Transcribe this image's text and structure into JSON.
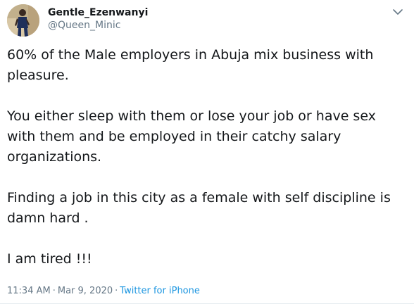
{
  "user": {
    "display_name": "Gentle_Ezenwanyi",
    "handle": "@Queen_Minic",
    "avatar_icon": "profile-photo"
  },
  "tweet": {
    "paragraphs": [
      "60% of the Male employers in Abuja mix business with pleasure.",
      "You either sleep with them or lose your job or have sex with them and be employed in their catchy salary organizations.",
      "Finding a job in this city as a female with self discipline is damn hard .",
      "I am tired !!!"
    ]
  },
  "meta": {
    "time": "11:34 AM",
    "separator1": "·",
    "date": "Mar 9, 2020",
    "separator2": "·",
    "source": "Twitter for iPhone"
  },
  "menu": {
    "icon": "chevron-down-icon"
  },
  "colors": {
    "text": "#14171a",
    "secondary": "#657786",
    "link": "#1b95e0"
  }
}
